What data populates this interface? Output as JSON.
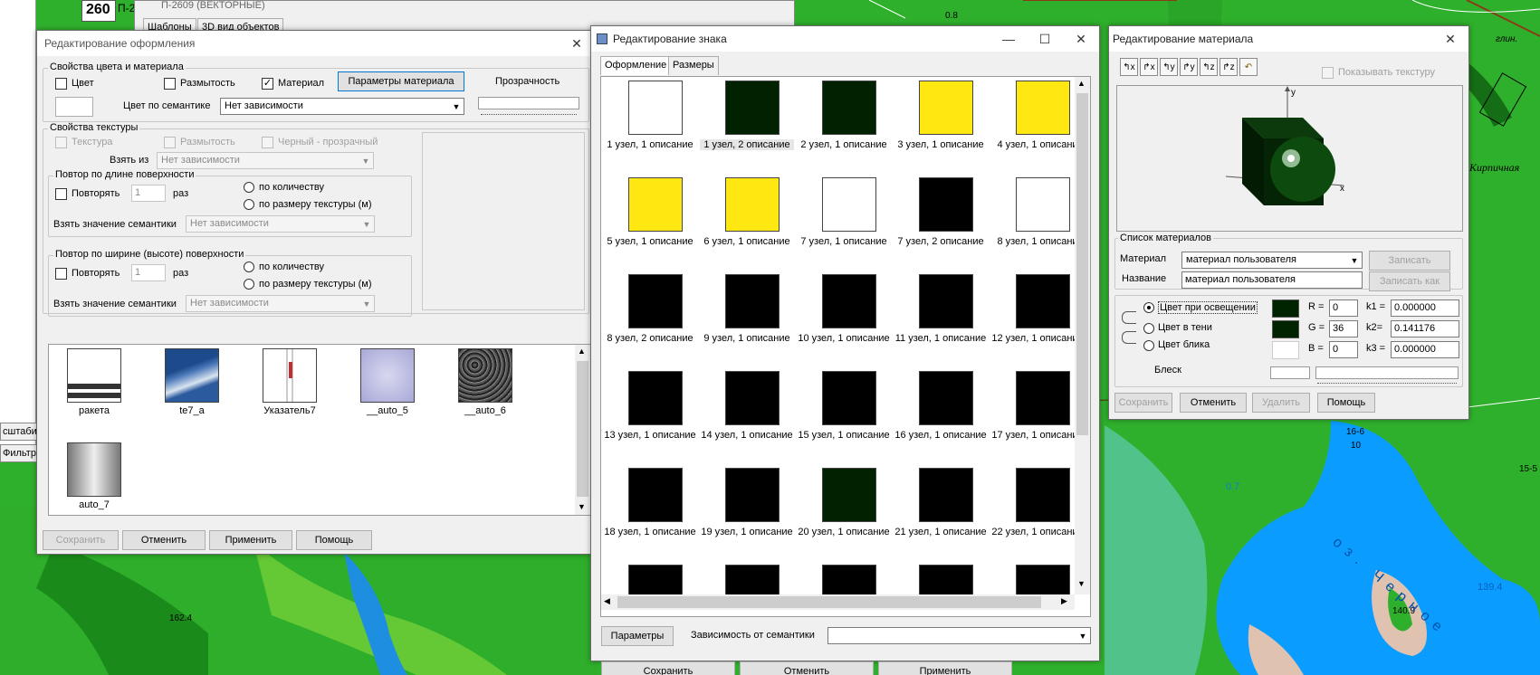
{
  "map": {
    "labels": [
      "0.8",
      "глин.",
      "Кирпичная",
      "16-6",
      "10",
      "15-5",
      "0.7",
      "139.4",
      "140.9",
      "162.4",
      "16",
      "оз. Черное"
    ],
    "top_num": "260",
    "top_text": "П-2",
    "left_tabs": [
      "сштаби",
      "Фильтр"
    ],
    "bg_window_title": "П-2609 (ВЕКТОРНЫЕ)",
    "bg_tabs": [
      "Шаблоны",
      "3D вид объектов"
    ]
  },
  "dlg1": {
    "title": "Редактирование оформления",
    "color_group": "Свойства цвета и материала",
    "cb_color": "Цвет",
    "cb_blur": "Размытость",
    "cb_material": "Материал",
    "material_params_btn": "Параметры материала",
    "transparency": "Прозрачность",
    "color_by_semantic": "Цвет по семантике",
    "semantic_value": "Нет зависимости",
    "texture_group": "Свойства текстуры",
    "cb_texture": "Текстура",
    "cb_tex_blur": "Размытость",
    "cb_black_transparent": "Черный - прозрачный",
    "take_from": "Взять из",
    "take_from_value": "Нет зависимости",
    "repeat_length_group": "Повтор по длине поверхности",
    "repeat": "Повторять",
    "repeat_count": "1",
    "times": "раз",
    "by_count": "по количеству",
    "by_texture_size": "по размеру текстуры (м)",
    "take_semantic": "Взять значение семантики",
    "semantic_none": "Нет зависимости",
    "repeat_width_group": "Повтор по ширине (высоте) поверхности",
    "repeat2": "Повторять",
    "repeat_count2": "1",
    "times2": "раз",
    "by_count2": "по количеству",
    "by_texture_size2": "по размеру текстуры (м)",
    "take_semantic2": "Взять значение семантики",
    "semantic_none2": "Нет зависимости",
    "textures": [
      "ракета",
      "te7_a",
      "Указатель7",
      "__auto_5",
      "__auto_6",
      "auto_7"
    ],
    "buttons": {
      "save": "Сохранить",
      "cancel": "Отменить",
      "apply": "Применить",
      "help": "Помощь"
    }
  },
  "dlg2": {
    "title": "Редактирование знака",
    "tabs": [
      "Оформление",
      "Размеры"
    ],
    "swatch_colors": [
      "#ffffff",
      "#002200",
      "#002200",
      "#ffe812",
      "#ffe812",
      "#ffe812",
      "#ffe812",
      "#ffffff",
      "#000000",
      "#ffffff",
      "#000000",
      "#000000",
      "#000000",
      "#000000",
      "#000000",
      "#000000",
      "#000000",
      "#000000",
      "#000000",
      "#000000",
      "#000000",
      "#000000",
      "#002200",
      "#000000",
      "#000000"
    ],
    "swatch_labels": [
      "1 узел, 1 описание",
      "1 узел, 2 описание",
      "2 узел, 1 описание",
      "3 узел, 1 описание",
      "4 узел, 1 описани",
      "5 узел, 1 описание",
      "6 узел, 1 описание",
      "7 узел, 1 описание",
      "7 узел, 2 описание",
      "8 узел, 1 описани",
      "8 узел, 2 описание",
      "9 узел, 1 описание",
      "10 узел, 1 описание",
      "11 узел, 1 описание",
      "12 узел, 1 описание",
      "13 узел, 1 описание",
      "14 узел, 1 описание",
      "15 узел, 1 описание",
      "16 узел, 1 описание",
      "17 узел, 1 описание",
      "18 узел, 1 описание",
      "19 узел, 1 описание",
      "20 узел, 1 описание",
      "21 узел, 1 описание",
      "22 узел, 1 описание"
    ],
    "params_btn": "Параметры",
    "semantic_dep": "Зависимость от семантики",
    "buttons": {
      "save": "Сохранить",
      "cancel": "Отменить",
      "apply": "Применить"
    }
  },
  "dlg3": {
    "title": "Редактирование материала",
    "show_texture": "Показывать текстуру",
    "axis_y": "y",
    "axis_x": "x",
    "materials_group": "Список материалов",
    "material_label": "Материал",
    "material_value": "материал пользователя",
    "name_label": "Название",
    "name_value": "материал пользователя",
    "write_btn": "Записать",
    "write_as_btn": "Записать как",
    "rb_lit": "Цвет при освещении",
    "rb_shadow": "Цвет в тени",
    "rb_highlight": "Цвет блика",
    "r_label": "R =",
    "g_label": "G =",
    "b_label": "B =",
    "r_value": "0",
    "g_value": "36",
    "b_value": "0",
    "k1_label": "k1 =",
    "k2_label": "k2=",
    "k3_label": "k3 =",
    "k1_value": "0.000000",
    "k2_value": "0.141176",
    "k3_value": "0.000000",
    "shine": "Блеск",
    "buttons": {
      "save": "Сохранить",
      "cancel": "Отменить",
      "delete": "Удалить",
      "help": "Помощь"
    },
    "colors": {
      "lit": "#002400",
      "shadow": "#002400",
      "highlight": "#ffffff"
    }
  }
}
